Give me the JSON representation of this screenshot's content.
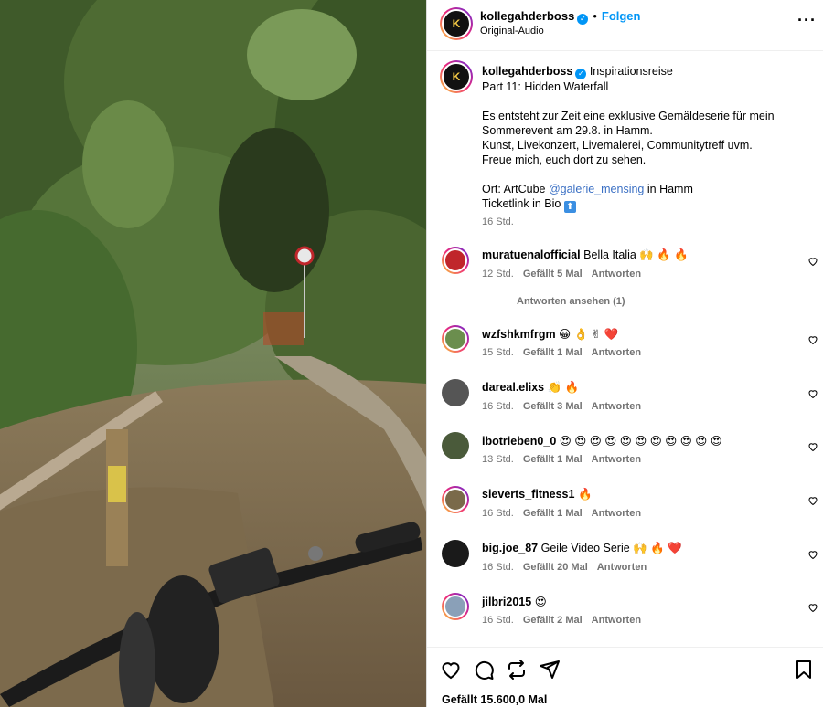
{
  "header": {
    "username": "kollegahderboss",
    "follow_label": "Folgen",
    "separator": "•",
    "audio_label": "Original-Audio",
    "more_label": "···"
  },
  "caption": {
    "username": "kollegahderboss",
    "title": "Inspirationsreise",
    "lines": [
      "Part 11: Hidden Waterfall",
      "",
      "Es entsteht zur Zeit eine exklusive Gemäldeserie für mein",
      "Sommerevent am 29.8. in Hamm.",
      "Kunst, Livekonzert, Livemalerei, Communitytreff uvm.",
      "Freue mich, euch dort zu sehen.",
      ""
    ],
    "location_prefix": "Ort: ArtCube",
    "location_mention": "@galerie_mensing",
    "location_suffix": "in Hamm",
    "ticket_text": "Ticketlink in Bio",
    "ticket_icon": "⬆",
    "time": "16 Std."
  },
  "view_replies_label": "Antworten ansehen (1)",
  "reply_label": "Antworten",
  "comments": [
    {
      "user": "muratuenalofficial",
      "text": "Bella Italia 🙌 🔥 🔥",
      "time": "12 Std.",
      "likes": "Gefällt 5 Mal",
      "avatar_color": "#c0262b"
    },
    {
      "user": "wzfshkmfrgm",
      "text": "😀 👌 ✌ ❤️",
      "time": "15 Std.",
      "likes": "Gefällt 1 Mal",
      "avatar_color": "#6b8e4e"
    },
    {
      "user": "dareal.elixs",
      "text": "👏 🔥",
      "time": "16 Std.",
      "likes": "Gefällt 3 Mal",
      "avatar_color": "#555555"
    },
    {
      "user": "ibotrieben0_0",
      "text": "😍 😍 😍 😍 😍 😍 😍 😍 😍 😍 😍",
      "time": "13 Std.",
      "likes": "Gefällt 1 Mal",
      "avatar_color": "#4a5a3a"
    },
    {
      "user": "sieverts_fitness1",
      "text": "🔥",
      "time": "16 Std.",
      "likes": "Gefällt 1 Mal",
      "avatar_color": "#7a6a4a"
    },
    {
      "user": "big.joe_87",
      "text": "Geile Video Serie 🙌 🔥 ❤️",
      "time": "16 Std.",
      "likes": "Gefällt 20 Mal",
      "avatar_color": "#1a1a1a"
    },
    {
      "user": "jilbri2015",
      "text": "😍",
      "time": "16 Std.",
      "likes": "Gefällt 2 Mal",
      "avatar_color": "#8aa0b8"
    }
  ],
  "actions": {
    "icons": [
      "heart-icon",
      "comment-icon",
      "share-icon",
      "send-icon",
      "bookmark-icon"
    ],
    "likes_text": "Gefällt 15.600,0 Mal"
  },
  "colors": {
    "accent": "#0095f6",
    "meta_gray": "#737373",
    "mention": "#3b70c4"
  }
}
